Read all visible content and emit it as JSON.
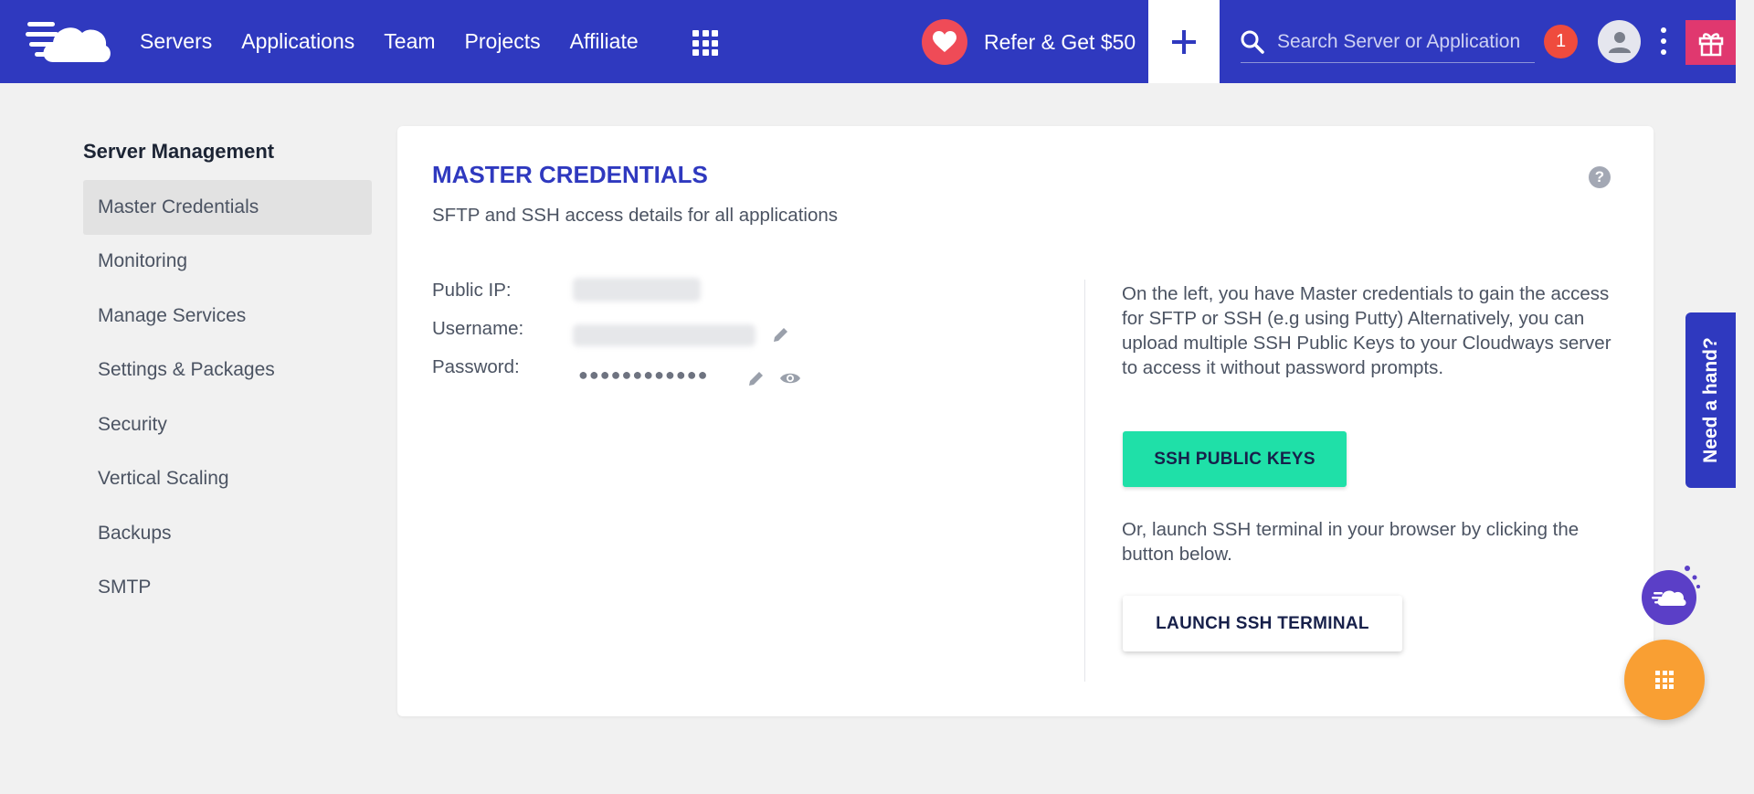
{
  "topbar": {
    "logo_icon": "cloudways-logo-icon",
    "nav": [
      {
        "label": "Servers"
      },
      {
        "label": "Applications"
      },
      {
        "label": "Team"
      },
      {
        "label": "Projects"
      },
      {
        "label": "Affiliate"
      }
    ],
    "apps_icon": "grid-icon",
    "refer_label": "Refer & Get $50",
    "refer_icon": "heart-icon",
    "add_icon": "plus-icon",
    "search": {
      "placeholder": "Search Server or Application",
      "icon": "search-icon"
    },
    "notification_count": "1",
    "avatar_icon": "user-icon",
    "more_icon": "kebab-menu-icon",
    "gift_icon": "gift-icon",
    "brand_color": "#2f39bf"
  },
  "sidebar": {
    "title": "Server Management",
    "items": [
      {
        "label": "Master Credentials",
        "active": true
      },
      {
        "label": "Monitoring"
      },
      {
        "label": "Manage Services"
      },
      {
        "label": "Settings & Packages"
      },
      {
        "label": "Security"
      },
      {
        "label": "Vertical Scaling"
      },
      {
        "label": "Backups"
      },
      {
        "label": "SMTP"
      }
    ]
  },
  "card": {
    "title": "MASTER CREDENTIALS",
    "subtitle": "SFTP and SSH access details for all applications",
    "help_label": "?",
    "fields": {
      "public_ip_label": "Public IP:",
      "username_label": "Username:",
      "password_label": "Password:",
      "password_mask": "●●●●●●●●●●●●"
    },
    "info_text_1": "On the left, you have Master credentials to gain the access for SFTP or SSH (e.g using Putty) Alternatively, you can upload multiple SSH Public Keys to your Cloudways server to access it without password prompts.",
    "ssh_keys_button": "SSH PUBLIC KEYS",
    "info_text_2": "Or, launch SSH terminal in your browser by clicking the button below.",
    "launch_terminal_button": "LAUNCH SSH TERMINAL",
    "accent_color": "#1fe0a8"
  },
  "floating": {
    "need_hand_label": "Need a hand?",
    "bot_icon": "cloudbot-icon",
    "fab_icon": "grid-icon",
    "fab_color": "#f99f33"
  }
}
